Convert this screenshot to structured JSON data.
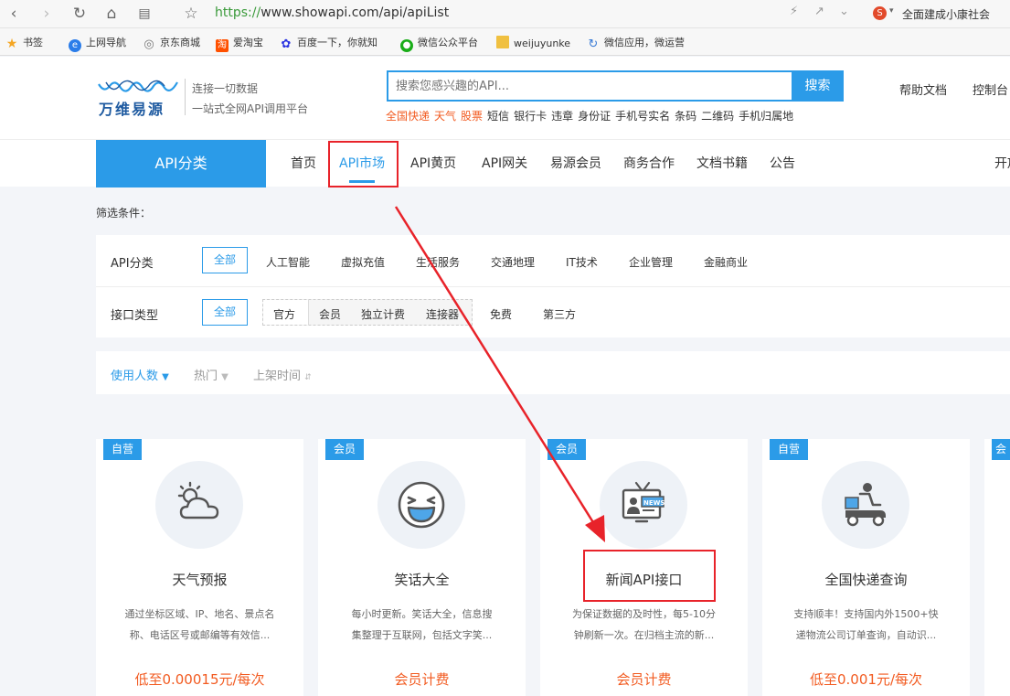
{
  "browser": {
    "url_protocol": "https://",
    "url_rest": "www.showapi.com/api/apiList",
    "news_tip": "全面建成小康社会",
    "bookmarks": [
      {
        "label": "书签",
        "icon": "star-icon",
        "color": "#f5a623"
      },
      {
        "label": "上网导航",
        "icon": "ie-icon",
        "color": "#2b7de9"
      },
      {
        "label": "京东商城",
        "icon": "globe-icon",
        "color": "#777777"
      },
      {
        "label": "爱淘宝",
        "icon": "taobao-icon",
        "color": "#ff5000"
      },
      {
        "label": "百度一下，你就知",
        "icon": "baidu-icon",
        "color": "#2932e1"
      },
      {
        "label": "微信公众平台",
        "icon": "wechat-icon",
        "color": "#1aad19"
      },
      {
        "label": "weijuyunke",
        "icon": "folder-icon",
        "color": "#f0c040"
      },
      {
        "label": "微信应用，微运营",
        "icon": "loading-icon",
        "color": "#3a7bd5"
      }
    ]
  },
  "header": {
    "logo_text": "万维易源",
    "slogan_line1": "连接一切数据",
    "slogan_line2": "一站式全网API调用平台",
    "search_placeholder": "搜索您感兴趣的API...",
    "search_button": "搜索",
    "hot_links": [
      {
        "label": "全国快递",
        "hot": true
      },
      {
        "label": "天气",
        "hot": true
      },
      {
        "label": "股票",
        "hot": true
      },
      {
        "label": "短信",
        "hot": false
      },
      {
        "label": "银行卡",
        "hot": false
      },
      {
        "label": "违章",
        "hot": false
      },
      {
        "label": "身份证",
        "hot": false
      },
      {
        "label": "手机号实名",
        "hot": false
      },
      {
        "label": "条码",
        "hot": false
      },
      {
        "label": "二维码",
        "hot": false
      },
      {
        "label": "手机归属地",
        "hot": false
      }
    ],
    "help": "帮助文档",
    "console": "控制台"
  },
  "nav": {
    "category_button": "API分类",
    "items": [
      "首页",
      "API市场",
      "API黄页",
      "API网关",
      "易源会员",
      "商务合作",
      "文档书籍",
      "公告",
      "开放"
    ],
    "active_index": 1
  },
  "filters": {
    "title": "筛选条件：",
    "category_label": "API分类",
    "all": "全部",
    "categories": [
      "人工智能",
      "虚拟充值",
      "生活服务",
      "交通地理",
      "IT技术",
      "企业管理",
      "金融商业"
    ],
    "type_label": "接口类型",
    "type_group": [
      "官方",
      "会员",
      "独立计费",
      "连接器"
    ],
    "type_extra": [
      "免费",
      "第三方"
    ]
  },
  "sort": {
    "options": [
      "使用人数",
      "热门",
      "上架时间"
    ],
    "active_index": 0
  },
  "cards": [
    {
      "badge": "自营",
      "icon": "weather-icon",
      "title": "天气预报",
      "desc1": "通过坐标区域、IP、地名、景点名",
      "desc2": "称、电话区号或邮编等有效信...",
      "price": "低至0.00015元/每次"
    },
    {
      "badge": "会员",
      "icon": "laugh-icon",
      "title": "笑话大全",
      "desc1": "每小时更新。笑话大全，信息搜",
      "desc2": "集整理于互联网，包括文字笑...",
      "price": "会员计费"
    },
    {
      "badge": "会员",
      "icon": "news-tv-icon",
      "title": "新闻API接口",
      "desc1": "为保证数据的及时性，每5-10分",
      "desc2": "钟刷新一次。在归档主流的新...",
      "price": "会员计费"
    },
    {
      "badge": "自营",
      "icon": "delivery-icon",
      "title": "全国快递查询",
      "desc1": "支持顺丰！支持国内外1500+快",
      "desc2": "递物流公司订单查询，自动识...",
      "price": "低至0.001元/每次"
    }
  ],
  "partial_card_badge": "会员",
  "annotation_color": "#e8232a",
  "accent_color": "#2b9be8",
  "price_color": "#f25b21"
}
